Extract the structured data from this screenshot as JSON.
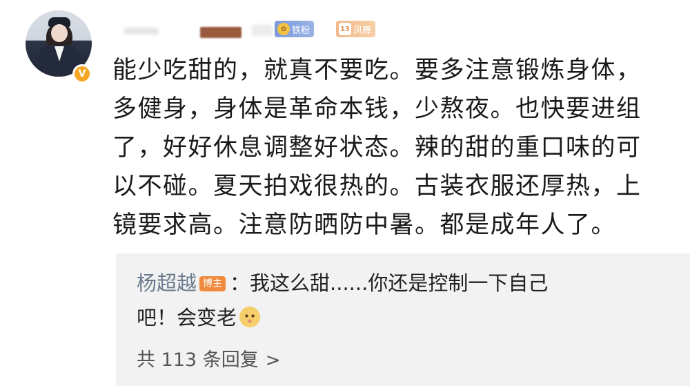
{
  "user": {
    "badges": {
      "fan_label": "铁粉",
      "fan_icon": "fan-medal-icon",
      "level_number": "13",
      "level_label": "凤舞"
    },
    "verified_icon": "verified-v-icon",
    "verified_glyph": "V"
  },
  "comment": {
    "lines": [
      "能少吃甜的，就真不要吃。要多注意锻炼身体，",
      "多健身，身体是革命本钱，少熬夜。也快要进组",
      "了，好好休息调整好状态。辣的甜的重口味的可",
      "以不碰。夏天拍戏很热的。古装衣服还厚热，上",
      "镜要求高。注意防晒防中暑。都是成年人了。"
    ]
  },
  "reply": {
    "author": "杨超越",
    "role_badge": "博主",
    "line1_text": "：我这么甜......你还是控制一下自己",
    "line2_text": "吧！会变老",
    "emoji": "blush-emoji-icon"
  },
  "replies_link": {
    "label": "共 113 条回复",
    "chevron": ">"
  },
  "colors": {
    "reply_bg": "#f2f2f2",
    "author_link": "#6b7b8d",
    "role_badge": "#f08a3c",
    "verified": "#f5a623"
  }
}
